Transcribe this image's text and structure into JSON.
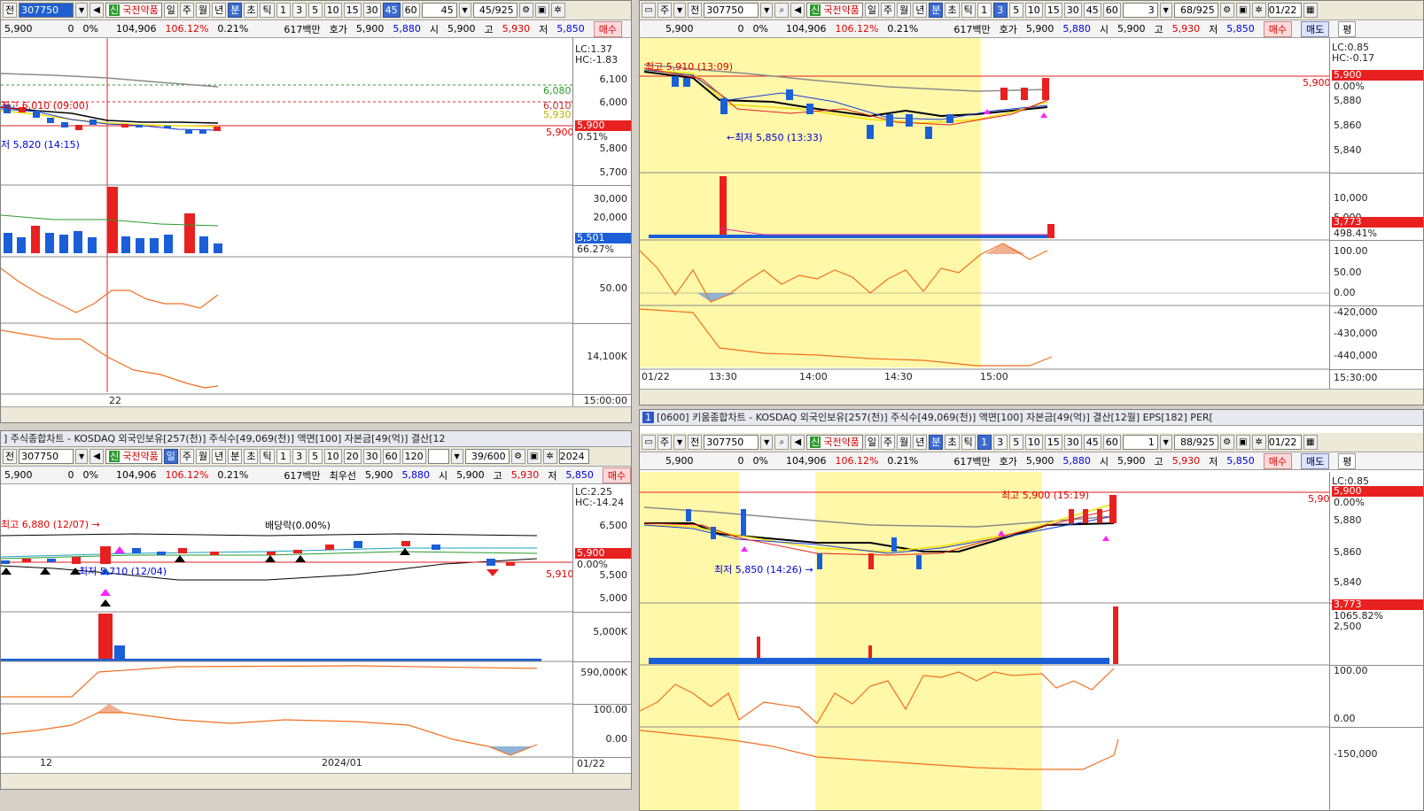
{
  "stock": {
    "code": "307750",
    "name_badge": "신",
    "name": "국전약품",
    "price": "5,900",
    "change": "0",
    "change_pct": "0%",
    "volume": "104,906",
    "vol_ratio": "106.12%",
    "turnover": "0.21%",
    "amount": "617백만",
    "hoga_label": "호가",
    "hoga_price": "5,900",
    "hoga_bid": "5,880",
    "open_label": "시",
    "open": "5,900",
    "high_label": "고",
    "high": "5,930",
    "low_label": "저",
    "low": "5,850",
    "best_label": "최우선",
    "buy_label": "매수",
    "sell_label": "매도",
    "eval_label": "평"
  },
  "toolbar": {
    "jeon": "전",
    "ju": "주",
    "period_buttons": [
      "일",
      "주",
      "월",
      "년",
      "분",
      "초",
      "틱"
    ],
    "interval_buttons_min": [
      "1",
      "3",
      "5",
      "10",
      "15",
      "30",
      "45",
      "60"
    ],
    "interval_buttons_day": [
      "1",
      "3",
      "5",
      "10",
      "20",
      "30",
      "60",
      "120"
    ],
    "date": "01/22",
    "p1_interval": "45",
    "p1_count": "45/925",
    "p2_interval": "3",
    "p2_count": "68/925",
    "p3_count": "39/600",
    "p3_year": "2024",
    "p4_interval": "1",
    "p4_count": "88/925"
  },
  "titles": {
    "p3": "] 주식종합차트 - KOSDAQ 외국인보유[257(천)] 주식수[49,069(천)] 액면[100] 자본금[49(억)] 결산[12",
    "p4_badge": "1",
    "p4": "[0600] 키움종합차트 - KOSDAQ 외국인보유[257(천)] 주식수[49,069(천)] 액면[100] 자본금[49(억)] 결산[12월] EPS[182] PER["
  },
  "pane1": {
    "lc": "LC:1.37",
    "hc": "HC:-1.83",
    "price_ticks": [
      "6,100",
      "6,000",
      "5,900",
      "5,800",
      "5,700"
    ],
    "ma_tags": [
      "6,080",
      "6,010",
      "5,930"
    ],
    "price_tag": "5,900",
    "price_tag_pct": "0.51%",
    "last_line_label": "5,900",
    "high_note": "최고 6,010 (09:00)",
    "low_note": "저 5,820 (14:15)",
    "vol_ticks": [
      "30,000",
      "20,000"
    ],
    "vol_tag": "5,501",
    "vol_tag_pct": "66.27%",
    "osc_tick": "50.00",
    "obv_tick": "14,100K",
    "time_tick": "15:00:00",
    "date_label": "22"
  },
  "pane2": {
    "lc": "LC:0.85",
    "hc": "HC:-0.17",
    "price_ticks": [
      "5,880",
      "5,860",
      "5,840"
    ],
    "price_tag": "5,900",
    "price_tag_pct": "0.00%",
    "last_line_label": "5,900",
    "high_note": "최고 5,910 (13:09)",
    "low_note": "←최저 5,850 (13:33)",
    "vol_ticks": [
      "10,000",
      "5,000"
    ],
    "vol_tag": "3,773",
    "vol_tag_pct": "498.41%",
    "osc_ticks": [
      "100.00",
      "50.00",
      "0.00"
    ],
    "obv_ticks": [
      "-420,000",
      "-430,000",
      "-440,000"
    ],
    "time_ticks": [
      "01/22",
      "13:30",
      "14:00",
      "14:30",
      "15:00"
    ],
    "time_end": "15:30:00"
  },
  "pane3": {
    "lc": "LC:2.25",
    "hc": "HC:-14.24",
    "price_ticks": [
      "6,500",
      "6,000",
      "5,500",
      "5,000"
    ],
    "price_tag": "5,900",
    "price_tag_pct": "0.00%",
    "last_line_label": "5,910",
    "high_note": "최고 6,880 (12/07) →",
    "low_note": "최저 5,710 (12/04)",
    "dividend_note": "배당락(0.00%)",
    "vol_tick": "5,000K",
    "obv_tick": "590,000K",
    "osc_ticks": [
      "100.00",
      "0.00"
    ],
    "date_ticks": [
      "12",
      "2024/01"
    ],
    "date_end": "01/22"
  },
  "pane4": {
    "lc": "LC:0.85",
    "price_ticks": [
      "5,880",
      "5,860",
      "5,840"
    ],
    "price_tag": "5,900",
    "price_tag_pct": "0.00%",
    "last_line_label": "5,900",
    "high_note": "최고 5,900 (15:19)",
    "low_note": "최저 5,850 (14:26) →",
    "vol_tick": "2,500",
    "vol_tag": "3,773",
    "vol_tag_pct": "1065.82%",
    "osc_ticks": [
      "100.00",
      "0.00"
    ],
    "obv_tick": "-150,000"
  },
  "colors": {
    "up": "#e82020",
    "down": "#1a5fd8",
    "highlight": "#fff8a8",
    "ma_yellow": "#f0e000",
    "ma_black": "#000000",
    "ma_gray": "#8a8a8a",
    "osc": "#f07020"
  }
}
